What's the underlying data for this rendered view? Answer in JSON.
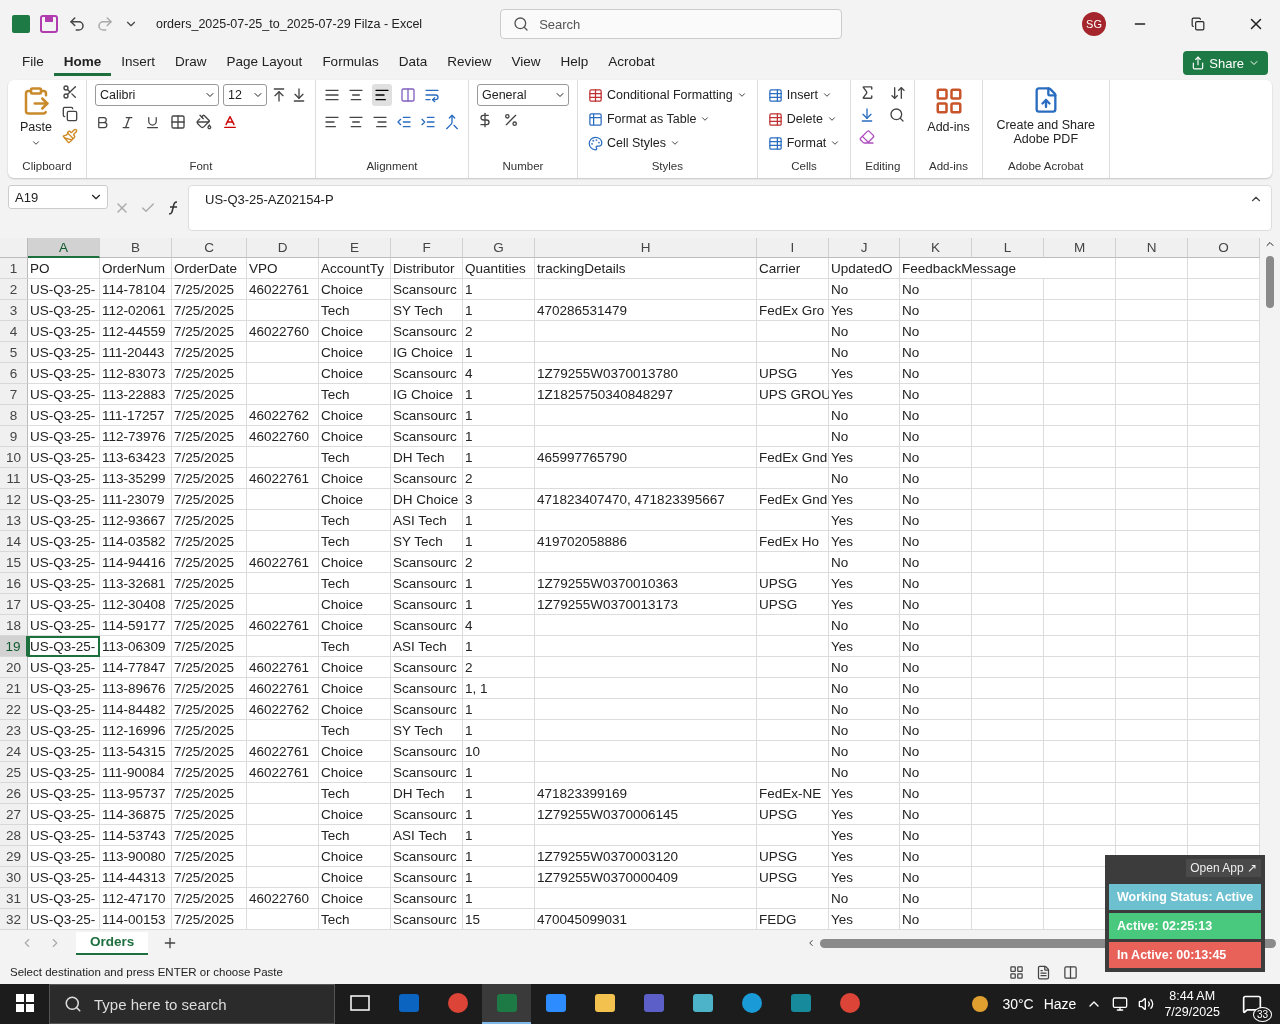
{
  "title_bar": {
    "title": "orders_2025-07-25_to_2025-07-29 Filza  -  Excel",
    "search_placeholder": "Search",
    "avatar": "SG"
  },
  "menu": [
    {
      "label": "File",
      "selected": false
    },
    {
      "label": "Home",
      "selected": true
    },
    {
      "label": "Insert",
      "selected": false
    },
    {
      "label": "Draw",
      "selected": false
    },
    {
      "label": "Page Layout",
      "selected": false
    },
    {
      "label": "Formulas",
      "selected": false
    },
    {
      "label": "Data",
      "selected": false
    },
    {
      "label": "Review",
      "selected": false
    },
    {
      "label": "View",
      "selected": false
    },
    {
      "label": "Help",
      "selected": false
    },
    {
      "label": "Acrobat",
      "selected": false
    }
  ],
  "share_button": "Share",
  "ribbon": [
    {
      "kind": "clipboard",
      "label": "Clipboard",
      "buttons": [
        "Paste"
      ]
    },
    {
      "kind": "font",
      "label": "Font",
      "font": "Calibri",
      "size": "12"
    },
    {
      "kind": "alignment",
      "label": "Alignment"
    },
    {
      "kind": "number",
      "label": "Number",
      "format": "General"
    },
    {
      "kind": "styles",
      "label": "Styles",
      "buttons": [
        "Conditional Formatting",
        "Format as Table",
        "Cell Styles"
      ]
    },
    {
      "kind": "cells",
      "label": "Cells",
      "buttons": [
        "Insert",
        "Delete",
        "Format"
      ]
    },
    {
      "kind": "editing",
      "label": "Editing"
    },
    {
      "kind": "addins",
      "label": "Add-ins",
      "buttons": [
        "Add-ins"
      ]
    },
    {
      "kind": "acrobat",
      "label": "Adobe Acrobat",
      "buttons": [
        "Create and Share Adobe PDF"
      ]
    }
  ],
  "formula_bar": {
    "name_box": "A19",
    "formula": "US-Q3-25-AZ02154-P"
  },
  "columns": [
    {
      "letter": "A",
      "selected": true
    },
    {
      "letter": "B",
      "selected": false
    },
    {
      "letter": "C",
      "selected": false
    },
    {
      "letter": "D",
      "selected": false
    },
    {
      "letter": "E",
      "selected": false
    },
    {
      "letter": "F",
      "selected": false
    },
    {
      "letter": "G",
      "selected": false
    },
    {
      "letter": "H",
      "selected": false
    },
    {
      "letter": "I",
      "selected": false
    },
    {
      "letter": "J",
      "selected": false
    },
    {
      "letter": "K",
      "selected": false
    },
    {
      "letter": "L",
      "selected": false
    },
    {
      "letter": "M",
      "selected": false
    },
    {
      "letter": "N",
      "selected": false
    },
    {
      "letter": "O",
      "selected": false
    }
  ],
  "rows": [
    {
      "number": "1",
      "selected": false,
      "cells": {
        "A": "PO",
        "B": "OrderNum",
        "C": "OrderDate",
        "D": "VPO",
        "E": "AccountTy",
        "F": "Distributor",
        "G": "Quantities",
        "H": "trackingDetails",
        "I": "Carrier",
        "J": "UpdatedO",
        "K": "FeedbackMessage"
      }
    },
    {
      "number": "2",
      "selected": false,
      "cells": {
        "A": "US-Q3-25-",
        "B": "114-78104",
        "C": "7/25/2025",
        "D": "46022761",
        "E": "Choice",
        "F": "Scansourc",
        "G": "1",
        "J": "No",
        "K": "No"
      }
    },
    {
      "number": "3",
      "selected": false,
      "cells": {
        "A": "US-Q3-25-",
        "B": "112-02061",
        "C": "7/25/2025",
        "E": "Tech",
        "F": "SY Tech",
        "G": "1",
        "H": "470286531479",
        "I": "FedEx Gro",
        "J": "Yes",
        "K": "No"
      }
    },
    {
      "number": "4",
      "selected": false,
      "cells": {
        "A": "US-Q3-25-",
        "B": "112-44559",
        "C": "7/25/2025",
        "D": "46022760",
        "E": "Choice",
        "F": "Scansourc",
        "G": "2",
        "J": "No",
        "K": "No"
      }
    },
    {
      "number": "5",
      "selected": false,
      "cells": {
        "A": "US-Q3-25-",
        "B": "111-20443",
        "C": "7/25/2025",
        "E": "Choice",
        "F": "IG Choice",
        "G": "1",
        "J": "No",
        "K": "No"
      }
    },
    {
      "number": "6",
      "selected": false,
      "cells": {
        "A": "US-Q3-25-",
        "B": "112-83073",
        "C": "7/25/2025",
        "E": "Choice",
        "F": "Scansourc",
        "G": "4",
        "H": "1Z79255W0370013780",
        "I": "UPSG",
        "J": "Yes",
        "K": "No"
      }
    },
    {
      "number": "7",
      "selected": false,
      "cells": {
        "A": "US-Q3-25-",
        "B": "113-22883",
        "C": "7/25/2025",
        "E": "Tech",
        "F": "IG Choice",
        "G": "1",
        "H": "1Z1825750340848297",
        "I": "UPS GROU",
        "J": "Yes",
        "K": "No"
      }
    },
    {
      "number": "8",
      "selected": false,
      "cells": {
        "A": "US-Q3-25-",
        "B": "111-17257",
        "C": "7/25/2025",
        "D": "46022762",
        "E": "Choice",
        "F": "Scansourc",
        "G": "1",
        "J": "No",
        "K": "No"
      }
    },
    {
      "number": "9",
      "selected": false,
      "cells": {
        "A": "US-Q3-25-",
        "B": "112-73976",
        "C": "7/25/2025",
        "D": "46022760",
        "E": "Choice",
        "F": "Scansourc",
        "G": "1",
        "J": "No",
        "K": "No"
      }
    },
    {
      "number": "10",
      "selected": false,
      "cells": {
        "A": "US-Q3-25-",
        "B": "113-63423",
        "C": "7/25/2025",
        "E": "Tech",
        "F": "DH Tech",
        "G": "1",
        "H": "465997765790",
        "I": "FedEx Gnd",
        "J": "Yes",
        "K": "No"
      }
    },
    {
      "number": "11",
      "selected": false,
      "cells": {
        "A": "US-Q3-25-",
        "B": "113-35299",
        "C": "7/25/2025",
        "D": "46022761",
        "E": "Choice",
        "F": "Scansourc",
        "G": "2",
        "J": "No",
        "K": "No"
      }
    },
    {
      "number": "12",
      "selected": false,
      "cells": {
        "A": "US-Q3-25-",
        "B": "111-23079",
        "C": "7/25/2025",
        "E": "Choice",
        "F": "DH Choice",
        "G": "3",
        "H": "471823407470, 471823395667",
        "I": "FedEx Gnd",
        "J": "Yes",
        "K": "No"
      }
    },
    {
      "number": "13",
      "selected": false,
      "cells": {
        "A": "US-Q3-25-",
        "B": "112-93667",
        "C": "7/25/2025",
        "E": "Tech",
        "F": "ASI Tech",
        "G": "1",
        "J": "Yes",
        "K": "No"
      }
    },
    {
      "number": "14",
      "selected": false,
      "cells": {
        "A": "US-Q3-25-",
        "B": "114-03582",
        "C": "7/25/2025",
        "E": "Tech",
        "F": "SY Tech",
        "G": "1",
        "H": "419702058886",
        "I": "FedEx Ho",
        "J": "Yes",
        "K": "No"
      }
    },
    {
      "number": "15",
      "selected": false,
      "cells": {
        "A": "US-Q3-25-",
        "B": "114-94416",
        "C": "7/25/2025",
        "D": "46022761",
        "E": "Choice",
        "F": "Scansourc",
        "G": "2",
        "J": "No",
        "K": "No"
      }
    },
    {
      "number": "16",
      "selected": false,
      "cells": {
        "A": "US-Q3-25-",
        "B": "113-32681",
        "C": "7/25/2025",
        "E": "Tech",
        "F": "Scansourc",
        "G": "1",
        "H": "1Z79255W0370010363",
        "I": "UPSG",
        "J": "Yes",
        "K": "No"
      }
    },
    {
      "number": "17",
      "selected": false,
      "cells": {
        "A": "US-Q3-25-",
        "B": "112-30408",
        "C": "7/25/2025",
        "E": "Choice",
        "F": "Scansourc",
        "G": "1",
        "H": "1Z79255W0370013173",
        "I": "UPSG",
        "J": "Yes",
        "K": "No"
      }
    },
    {
      "number": "18",
      "selected": false,
      "cells": {
        "A": "US-Q3-25-",
        "B": "114-59177",
        "C": "7/25/2025",
        "D": "46022761",
        "E": "Choice",
        "F": "Scansourc",
        "G": "4",
        "J": "No",
        "K": "No"
      }
    },
    {
      "number": "19",
      "selected": true,
      "cells": {
        "A": "US-Q3-25-",
        "B": "113-06309",
        "C": "7/25/2025",
        "E": "Tech",
        "F": "ASI Tech",
        "G": "1",
        "J": "Yes",
        "K": "No"
      }
    },
    {
      "number": "20",
      "selected": false,
      "cells": {
        "A": "US-Q3-25-",
        "B": "114-77847",
        "C": "7/25/2025",
        "D": "46022761",
        "E": "Choice",
        "F": "Scansourc",
        "G": "2",
        "J": "No",
        "K": "No"
      }
    },
    {
      "number": "21",
      "selected": false,
      "cells": {
        "A": "US-Q3-25-",
        "B": "113-89676",
        "C": "7/25/2025",
        "D": "46022761",
        "E": "Choice",
        "F": "Scansourc",
        "G": "1, 1",
        "J": "No",
        "K": "No"
      }
    },
    {
      "number": "22",
      "selected": false,
      "cells": {
        "A": "US-Q3-25-",
        "B": "114-84482",
        "C": "7/25/2025",
        "D": "46022762",
        "E": "Choice",
        "F": "Scansourc",
        "G": "1",
        "J": "No",
        "K": "No"
      }
    },
    {
      "number": "23",
      "selected": false,
      "cells": {
        "A": "US-Q3-25-",
        "B": "112-16996",
        "C": "7/25/2025",
        "E": "Tech",
        "F": "SY Tech",
        "G": "1",
        "J": "No",
        "K": "No"
      }
    },
    {
      "number": "24",
      "selected": false,
      "cells": {
        "A": "US-Q3-25-",
        "B": "113-54315",
        "C": "7/25/2025",
        "D": "46022761",
        "E": "Choice",
        "F": "Scansourc",
        "G": "10",
        "J": "No",
        "K": "No"
      }
    },
    {
      "number": "25",
      "selected": false,
      "cells": {
        "A": "US-Q3-25-",
        "B": "111-90084",
        "C": "7/25/2025",
        "D": "46022761",
        "E": "Choice",
        "F": "Scansourc",
        "G": "1",
        "J": "No",
        "K": "No"
      }
    },
    {
      "number": "26",
      "selected": false,
      "cells": {
        "A": "US-Q3-25-",
        "B": "113-95737",
        "C": "7/25/2025",
        "E": "Tech",
        "F": "DH Tech",
        "G": "1",
        "H": "471823399169",
        "I": "FedEx-NE",
        "J": "Yes",
        "K": "No"
      }
    },
    {
      "number": "27",
      "selected": false,
      "cells": {
        "A": "US-Q3-25-",
        "B": "114-36875",
        "C": "7/25/2025",
        "E": "Choice",
        "F": "Scansourc",
        "G": "1",
        "H": "1Z79255W0370006145",
        "I": "UPSG",
        "J": "Yes",
        "K": "No"
      }
    },
    {
      "number": "28",
      "selected": false,
      "cells": {
        "A": "US-Q3-25-",
        "B": "114-53743",
        "C": "7/25/2025",
        "E": "Tech",
        "F": "ASI Tech",
        "G": "1",
        "J": "Yes",
        "K": "No"
      }
    },
    {
      "number": "29",
      "selected": false,
      "cells": {
        "A": "US-Q3-25-",
        "B": "113-90080",
        "C": "7/25/2025",
        "E": "Choice",
        "F": "Scansourc",
        "G": "1",
        "H": "1Z79255W0370003120",
        "I": "UPSG",
        "J": "Yes",
        "K": "No"
      }
    },
    {
      "number": "30",
      "selected": false,
      "cells": {
        "A": "US-Q3-25-",
        "B": "114-44313",
        "C": "7/25/2025",
        "E": "Choice",
        "F": "Scansourc",
        "G": "1",
        "H": "1Z79255W0370000409",
        "I": "UPSG",
        "J": "Yes",
        "K": "No"
      }
    },
    {
      "number": "31",
      "selected": false,
      "cells": {
        "A": "US-Q3-25-",
        "B": "112-47170",
        "C": "7/25/2025",
        "D": "46022760",
        "E": "Choice",
        "F": "Scansourc",
        "G": "1",
        "J": "No",
        "K": "No"
      }
    },
    {
      "number": "32",
      "selected": false,
      "cells": {
        "A": "US-Q3-25-",
        "B": "114-00153",
        "C": "7/25/2025",
        "E": "Tech",
        "F": "Scansourc",
        "G": "15",
        "H": "470045099031",
        "I": "FEDG",
        "J": "Yes",
        "K": "No"
      }
    }
  ],
  "sheet_tabs": [
    {
      "label": "Orders",
      "selected": true
    }
  ],
  "status_bar": {
    "message": "Select destination and press ENTER or choose Paste"
  },
  "tracker": {
    "open_button": "Open App ↗",
    "status": "Working Status: Active",
    "active": "Active: 02:25:13",
    "inactive": "In Active: 00:13:45"
  },
  "taskbar": {
    "search_placeholder": "Type here to search",
    "apps": [
      {
        "kind": "taskview",
        "selected": false
      },
      {
        "kind": "outlook",
        "selected": false
      },
      {
        "kind": "chrome",
        "selected": false
      },
      {
        "kind": "excel",
        "selected": true
      },
      {
        "kind": "zoom",
        "selected": false
      },
      {
        "kind": "folder",
        "selected": false
      },
      {
        "kind": "teams",
        "selected": false
      },
      {
        "kind": "hex",
        "selected": false
      },
      {
        "kind": "edge",
        "selected": false
      },
      {
        "kind": "surfshark",
        "selected": false
      },
      {
        "kind": "chrome",
        "selected": false
      }
    ],
    "temperature": "30°C",
    "weather": "Haze",
    "time": "8:44 AM",
    "date": "7/29/2025",
    "notifications": "33"
  }
}
